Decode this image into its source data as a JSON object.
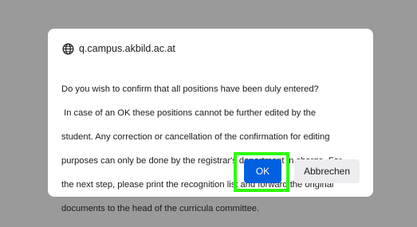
{
  "dialog": {
    "origin": "q.campus.akbild.ac.at",
    "message_lines": [
      "Do you wish to confirm that all positions have been duly entered?",
      " In case of an OK these positions cannot be further edited by the",
      "student. Any correction or cancellation of the confirmation for editing",
      "purposes can only be done by the registrar's department in charge. For",
      "the next step, please print the recognition list and forward the original",
      "documents to the head of the curricula committee."
    ],
    "ok_label": "OK",
    "cancel_label": "Abbrechen"
  },
  "icons": {
    "origin": "globe-icon"
  },
  "colors": {
    "overlay": "#9a9a9a",
    "dialog_bg": "#ffffff",
    "primary_button": "#0060df",
    "secondary_button": "#ededf0",
    "highlight": "#2cff0a"
  }
}
